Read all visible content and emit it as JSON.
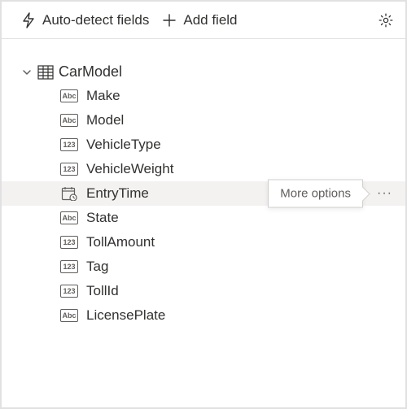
{
  "toolbar": {
    "auto_detect_label": "Auto-detect fields",
    "add_field_label": "Add field"
  },
  "tree": {
    "parent": {
      "name": "CarModel"
    },
    "fields": [
      {
        "type": "abc",
        "name": "Make",
        "hovered": false
      },
      {
        "type": "abc",
        "name": "Model",
        "hovered": false
      },
      {
        "type": "num",
        "name": "VehicleType",
        "hovered": false
      },
      {
        "type": "num",
        "name": "VehicleWeight",
        "hovered": false
      },
      {
        "type": "date",
        "name": "EntryTime",
        "hovered": true
      },
      {
        "type": "abc",
        "name": "State",
        "hovered": false
      },
      {
        "type": "num",
        "name": "TollAmount",
        "hovered": false
      },
      {
        "type": "num",
        "name": "Tag",
        "hovered": false
      },
      {
        "type": "num",
        "name": "TollId",
        "hovered": false
      },
      {
        "type": "abc",
        "name": "LicensePlate",
        "hovered": false
      }
    ]
  },
  "tooltip": {
    "text": "More options"
  },
  "badges": {
    "abc": "Abc",
    "num": "123"
  }
}
